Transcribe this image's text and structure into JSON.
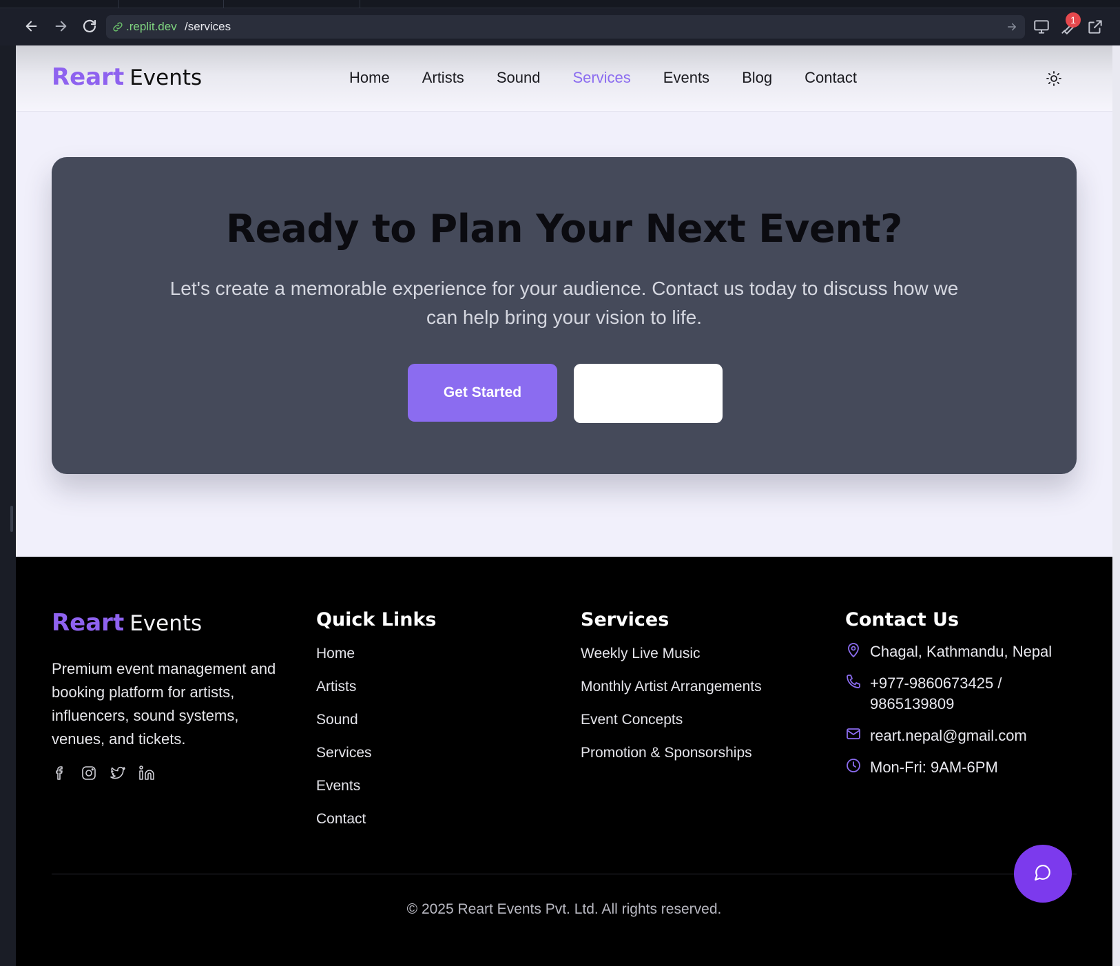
{
  "browser": {
    "url_host": ".replit.dev",
    "url_path": "/services",
    "notification_count": "1",
    "icons": [
      "back-arrow-icon",
      "forward-arrow-icon",
      "reload-icon",
      "link-icon",
      "go-arrow-icon",
      "monitor-icon",
      "wrench-icon",
      "external-link-icon"
    ]
  },
  "header": {
    "logo_part1": "Reart",
    "logo_part2": "Events",
    "nav": [
      {
        "label": "Home"
      },
      {
        "label": "Artists"
      },
      {
        "label": "Sound"
      },
      {
        "label": "Services",
        "active": true
      },
      {
        "label": "Events"
      },
      {
        "label": "Blog"
      },
      {
        "label": "Contact"
      }
    ],
    "theme_icon": "sun-icon"
  },
  "cta": {
    "title": "Ready to Plan Your Next Event?",
    "description": "Let's create a memorable experience for your audience. Contact us today to discuss how we can help bring your vision to life.",
    "primary_button": "Get Started",
    "secondary_button": ""
  },
  "footer": {
    "logo_part1": "Reart",
    "logo_part2": "Events",
    "about": "Premium event management and booking platform for artists, influencers, sound systems, venues, and tickets.",
    "socials": [
      "facebook-icon",
      "instagram-icon",
      "twitter-icon",
      "linkedin-icon"
    ],
    "quick_links": {
      "title": "Quick Links",
      "items": [
        "Home",
        "Artists",
        "Sound",
        "Services",
        "Events",
        "Contact"
      ]
    },
    "services": {
      "title": "Services",
      "items": [
        "Weekly Live Music",
        "Monthly Artist Arrangements",
        "Event Concepts",
        "Promotion & Sponsorships"
      ]
    },
    "contact": {
      "title": "Contact Us",
      "address": "Chagal, Kathmandu, Nepal",
      "phone": "+977-9860673425 / 9865139809",
      "email": "reart.nepal@gmail.com",
      "hours": "Mon-Fri: 9AM-6PM"
    },
    "copyright": "© 2025 Reart Events Pvt. Ltd. All rights reserved."
  },
  "colors": {
    "accent": "#8b6cf0",
    "brand": "#8e62ef",
    "cta_background": "#454a5a",
    "footer_background": "#000000",
    "chat_button": "#7c3aed"
  },
  "chat_icon": "chat-bubble-icon"
}
